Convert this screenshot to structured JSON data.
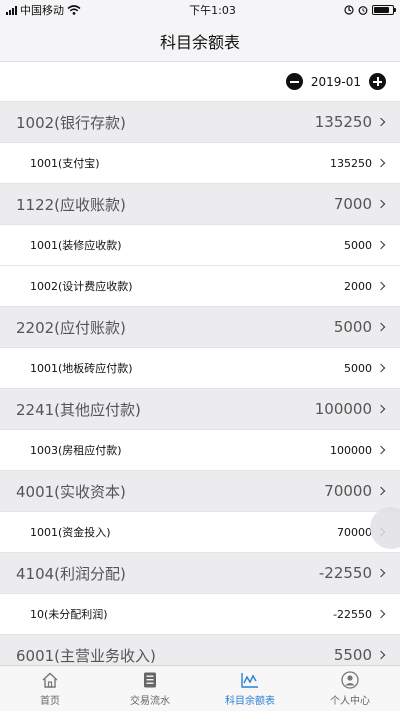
{
  "status_bar": {
    "carrier": "中国移动",
    "time": "下午1:03",
    "battery_level": 0.85
  },
  "header": {
    "title": "科目余额表"
  },
  "period": {
    "label": "2019-01"
  },
  "accounts": [
    {
      "name": "1002(银行存款)",
      "amount": "135250",
      "children": [
        {
          "name": "1001(支付宝)",
          "amount": "135250"
        }
      ]
    },
    {
      "name": "1122(应收账款)",
      "amount": "7000",
      "children": [
        {
          "name": "1001(装修应收款)",
          "amount": "5000"
        },
        {
          "name": "1002(设计费应收款)",
          "amount": "2000"
        }
      ]
    },
    {
      "name": "2202(应付账款)",
      "amount": "5000",
      "children": [
        {
          "name": "1001(地板砖应付款)",
          "amount": "5000"
        }
      ]
    },
    {
      "name": "2241(其他应付款)",
      "amount": "100000",
      "children": [
        {
          "name": "1003(房租应付款)",
          "amount": "100000"
        }
      ]
    },
    {
      "name": "4001(实收资本)",
      "amount": "70000",
      "children": [
        {
          "name": "1001(资金投入)",
          "amount": "70000"
        }
      ]
    },
    {
      "name": "4104(利润分配)",
      "amount": "-22550",
      "children": [
        {
          "name": "10(未分配利润)",
          "amount": "-22550"
        }
      ]
    },
    {
      "name": "6001(主营业务收入)",
      "amount": "5500",
      "children": []
    }
  ],
  "tabs": [
    {
      "label": "首页",
      "icon": "home-icon",
      "active": false
    },
    {
      "label": "交易流水",
      "icon": "ledger-icon",
      "active": false
    },
    {
      "label": "科目余额表",
      "icon": "chart-icon",
      "active": true
    },
    {
      "label": "个人中心",
      "icon": "user-icon",
      "active": false
    }
  ],
  "colors": {
    "accent": "#2a7fd4",
    "group_bg": "#ececef"
  }
}
